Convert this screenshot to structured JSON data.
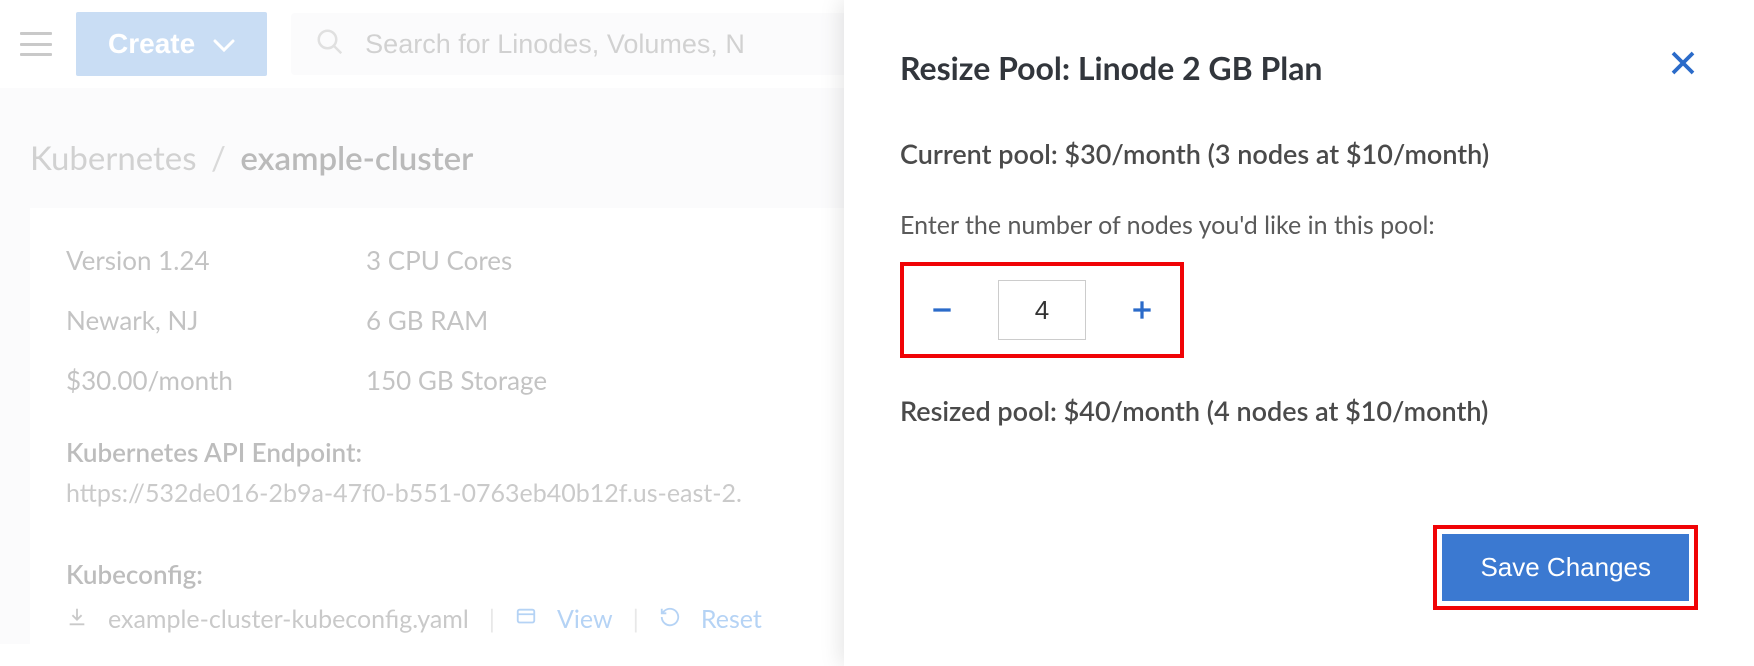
{
  "header": {
    "create_label": "Create",
    "search_placeholder": "Search for Linodes, Volumes, N"
  },
  "breadcrumb": {
    "root": "Kubernetes",
    "leaf": "example-cluster"
  },
  "cluster": {
    "version": "Version 1.24",
    "cores": "3 CPU Cores",
    "location": "Newark, NJ",
    "ram": "6 GB RAM",
    "price": "$30.00/month",
    "storage": "150 GB Storage",
    "api_endpoint_label": "Kubernetes API Endpoint:",
    "api_endpoint": "https://532de016-2b9a-47f0-b551-0763eb40b12f.us-east-2.",
    "kubeconfig_label": "Kubeconfig:",
    "kubeconfig_file": "example-cluster-kubeconfig.yaml",
    "view_label": "View",
    "reset_label": "Reset"
  },
  "drawer": {
    "title": "Resize Pool: Linode 2 GB Plan",
    "current_pool": "Current pool: $30/month (3 nodes at $10/month)",
    "instruction": "Enter the number of nodes you'd like in this pool:",
    "node_count": "4",
    "resized_pool": "Resized pool: $40/month (4 nodes at $10/month)",
    "save_label": "Save Changes"
  }
}
